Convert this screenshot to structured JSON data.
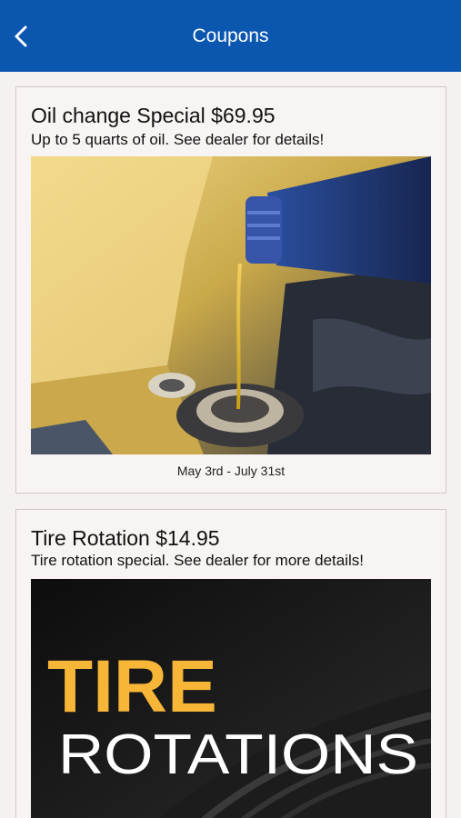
{
  "nav": {
    "title": "Coupons",
    "back_icon": "chevron-left-icon"
  },
  "coupons": [
    {
      "title": "Oil change Special $69.95",
      "description": "Up to 5 quarts of oil. See dealer for details!",
      "image": "oil-pouring-into-engine-photo",
      "dates": "May 3rd - July 31st"
    },
    {
      "title": "Tire Rotation $14.95",
      "description": "Tire rotation special.  See dealer for more details!",
      "image": "tire-rotations-promo-photo",
      "image_text_1": "TIRE",
      "image_text_2": "ROTATIONS"
    }
  ],
  "colors": {
    "nav": "#0b57b0",
    "accent": "#f7b637",
    "background": "#f5f1f0"
  }
}
